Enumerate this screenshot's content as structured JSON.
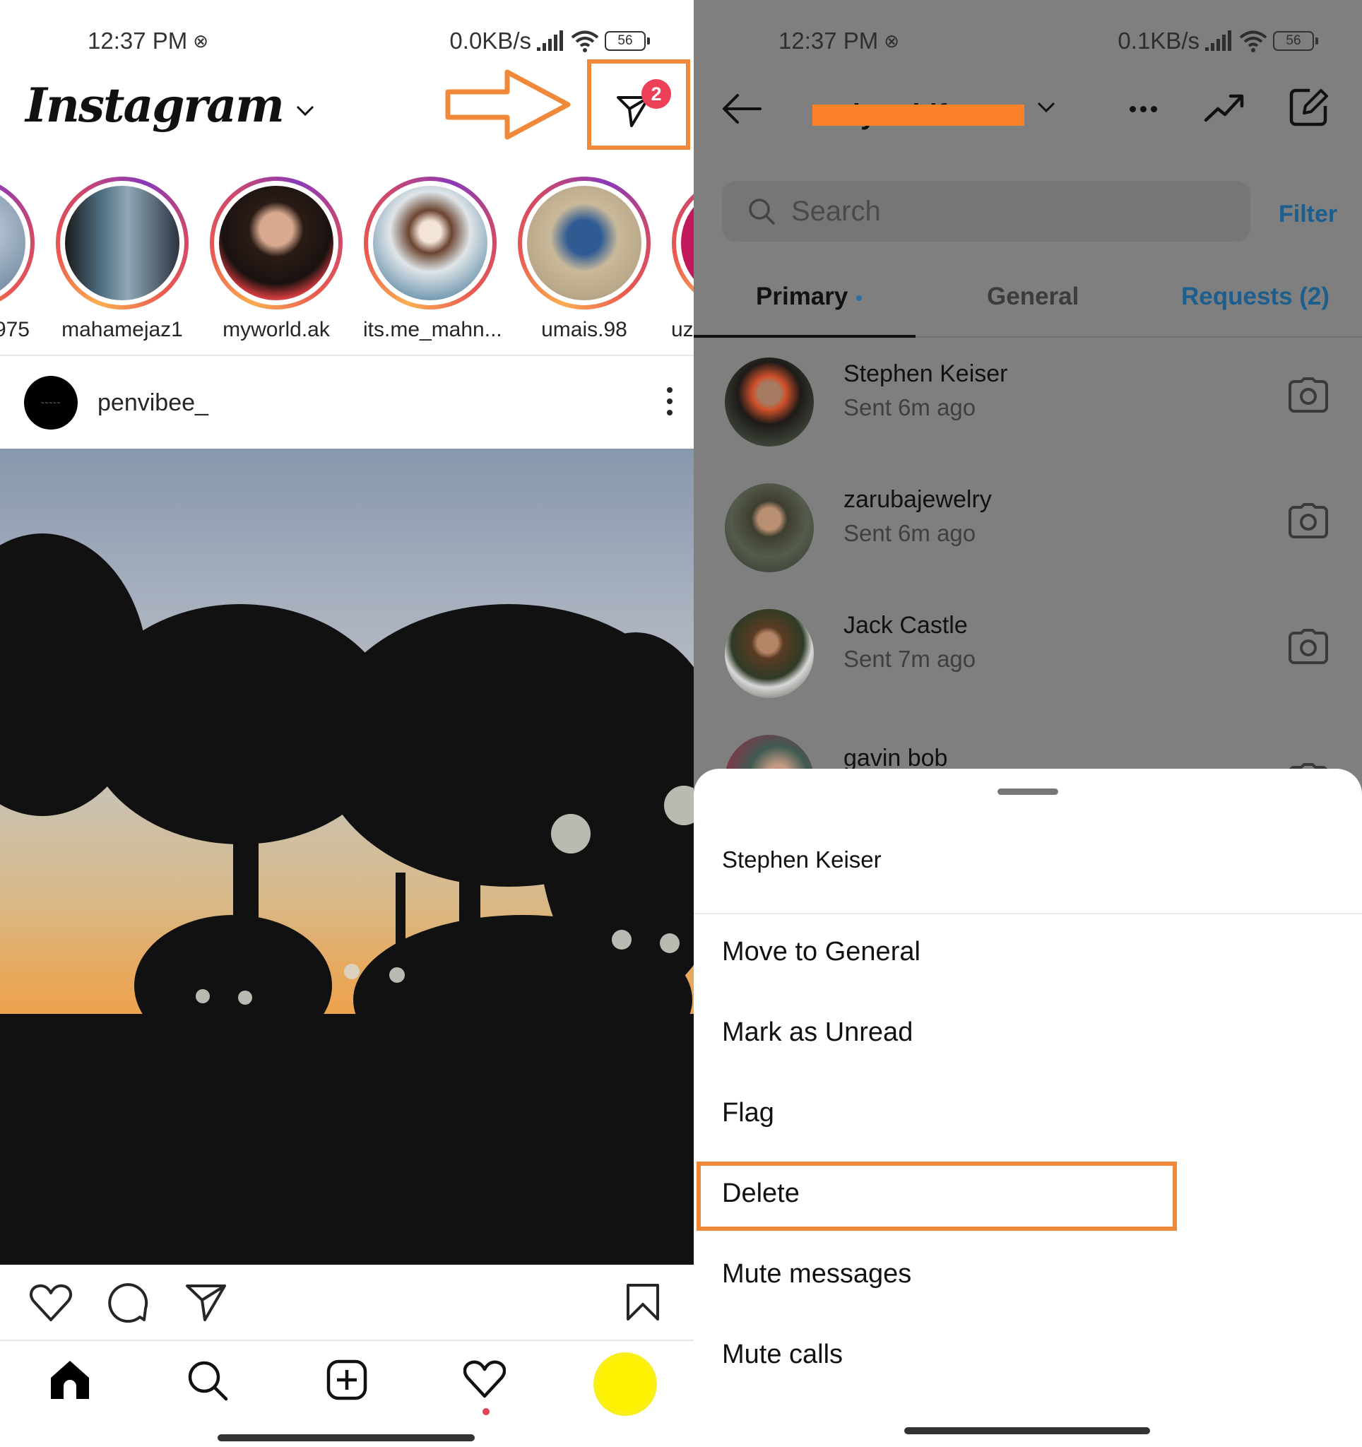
{
  "left_screen": {
    "status_bar": {
      "time": "12:37 PM",
      "network_speed": "0.0KB/s",
      "battery": "56"
    },
    "header": {
      "app_name": "Instagram",
      "dm_badge_count": "2"
    },
    "stories": [
      {
        "username": "975"
      },
      {
        "username": "mahamejaz1"
      },
      {
        "username": "myworld.ak"
      },
      {
        "username": "its.me_mahn..."
      },
      {
        "username": "umais.98"
      },
      {
        "username": "uz"
      }
    ],
    "post": {
      "username": "penvibee_"
    },
    "annotation_color": "#f0883a"
  },
  "right_screen": {
    "status_bar": {
      "time": "12:37 PM",
      "network_speed": "0.1KB/s",
      "battery": "56"
    },
    "header": {
      "username_redacted": "onlyarddfacts"
    },
    "search": {
      "placeholder": "Search",
      "filter_label": "Filter"
    },
    "tabs": [
      {
        "label": "Primary",
        "active": true,
        "unread_dot": true
      },
      {
        "label": "General",
        "active": false
      },
      {
        "label": "Requests (2)",
        "active": false
      }
    ],
    "threads": [
      {
        "name": "Stephen Keiser",
        "status": "Sent 6m ago"
      },
      {
        "name": "zarubajewelry",
        "status": "Sent 6m ago"
      },
      {
        "name": "Jack Castle",
        "status": "Sent 7m ago"
      },
      {
        "name": "gavin bob",
        "status": ""
      }
    ],
    "action_sheet": {
      "title": "Stephen Keiser",
      "items": [
        {
          "label": "Move to General"
        },
        {
          "label": "Mark as Unread"
        },
        {
          "label": "Flag"
        },
        {
          "label": "Delete",
          "highlighted": true
        },
        {
          "label": "Mute messages"
        },
        {
          "label": "Mute calls"
        }
      ]
    },
    "accent_color": "#1c5e8e"
  }
}
